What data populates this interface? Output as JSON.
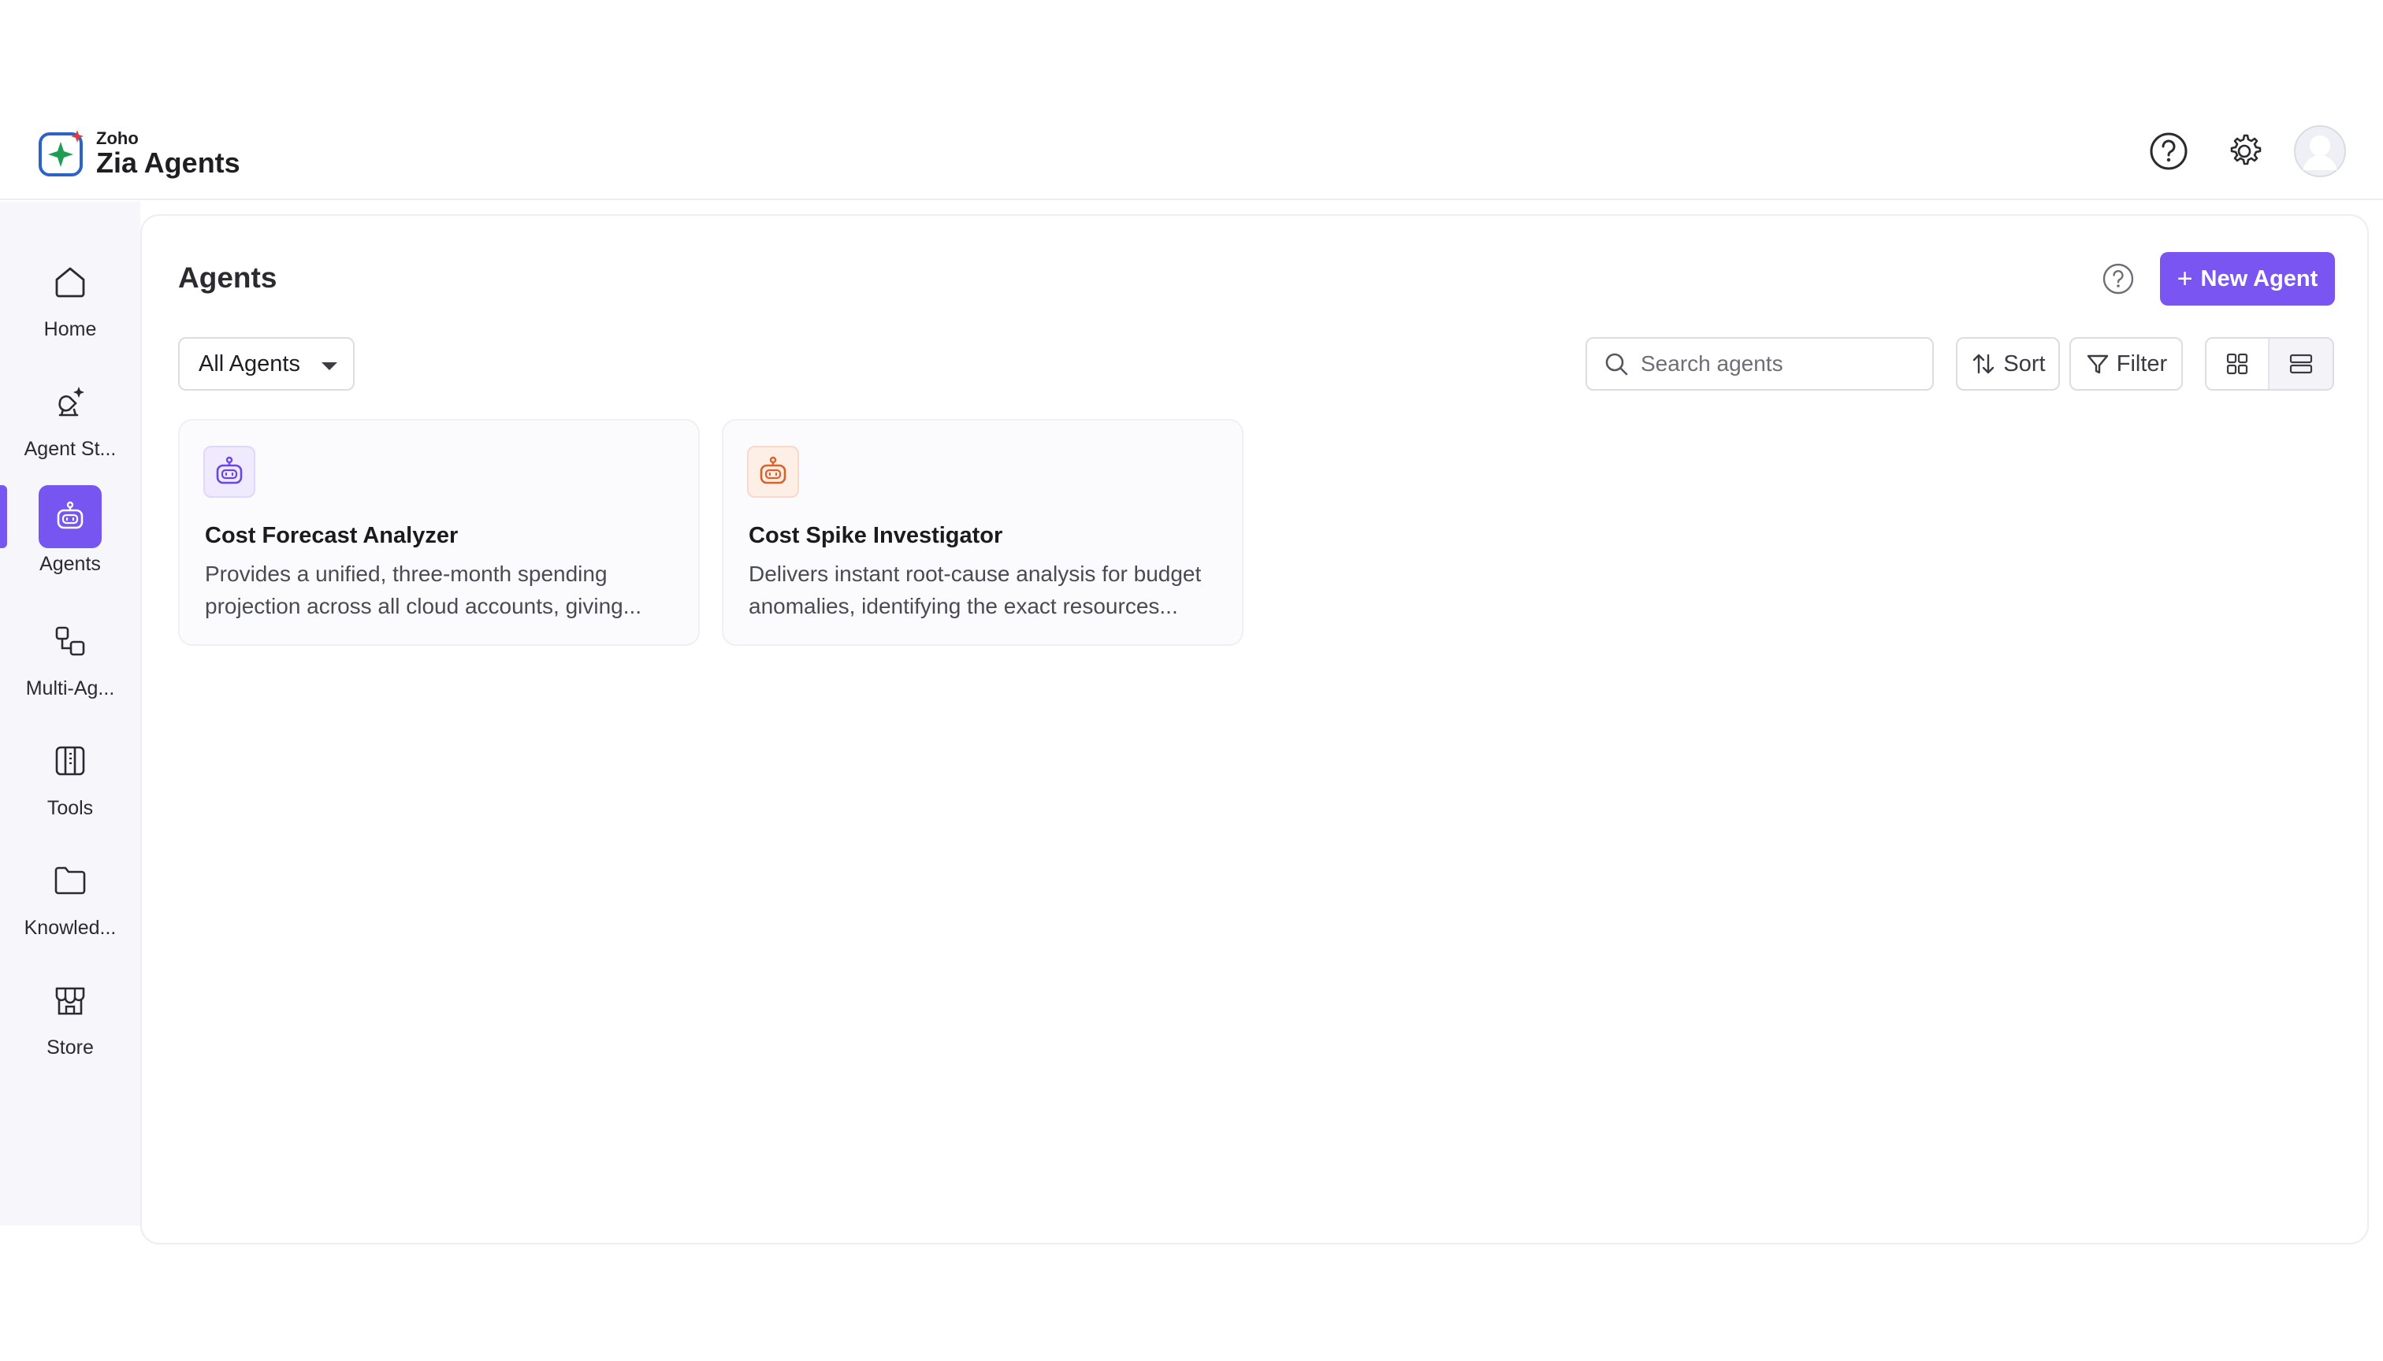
{
  "app": {
    "brand_sub": "Zoho",
    "brand_title": "Zia Agents"
  },
  "header": {
    "icons": [
      "help-icon",
      "gear-icon",
      "avatar"
    ]
  },
  "sidebar": {
    "items": [
      {
        "label": "Home",
        "icon": "home-icon",
        "active": false
      },
      {
        "label": "Agent St...",
        "icon": "agent-studio-icon",
        "active": false
      },
      {
        "label": "Agents",
        "icon": "robot-icon",
        "active": true
      },
      {
        "label": "Multi-Ag...",
        "icon": "multi-agent-icon",
        "active": false
      },
      {
        "label": "Tools",
        "icon": "tools-icon",
        "active": false
      },
      {
        "label": "Knowled...",
        "icon": "folder-icon",
        "active": false
      },
      {
        "label": "Store",
        "icon": "store-icon",
        "active": false
      }
    ]
  },
  "main": {
    "title": "Agents",
    "new_agent_label": "New Agent",
    "filter_dropdown": "All Agents",
    "search_placeholder": "Search agents",
    "sort_label": "Sort",
    "filter_label": "Filter",
    "view_mode": "grid"
  },
  "agents": [
    {
      "name": "Cost Forecast Analyzer",
      "description": "Provides a unified, three-month spending projection across all cloud accounts, giving...",
      "icon_color": "#6a45e8"
    },
    {
      "name": "Cost Spike Investigator",
      "description": "Delivers instant root-cause analysis for budget anomalies, identifying the exact resources...",
      "icon_color": "#d9622b"
    }
  ],
  "colors": {
    "accent": "#7a55f2",
    "sidebar_bg": "#f6f6fb"
  }
}
